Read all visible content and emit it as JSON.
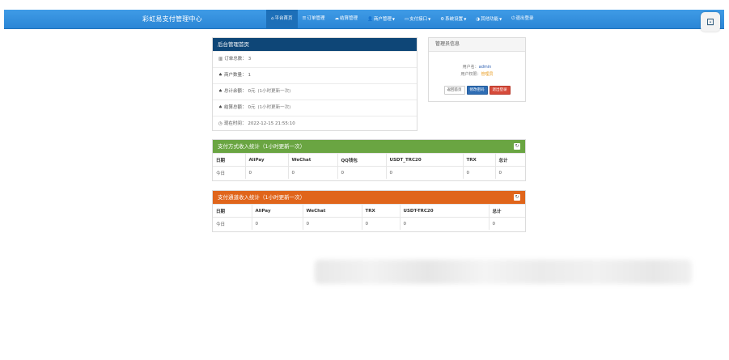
{
  "navbar": {
    "brand": "彩虹易支付管理中心",
    "items": [
      {
        "icon": "⌂",
        "label": "平台首页",
        "caret": false,
        "active": true
      },
      {
        "icon": "☰",
        "label": "订单管理",
        "caret": false,
        "active": false
      },
      {
        "icon": "☁",
        "label": "结算管理",
        "caret": false,
        "active": false
      },
      {
        "icon": "👤",
        "label": "商户管理",
        "caret": true,
        "active": false
      },
      {
        "icon": "▭",
        "label": "支付接口",
        "caret": true,
        "active": false
      },
      {
        "icon": "⚙",
        "label": "系统设置",
        "caret": true,
        "active": false
      },
      {
        "icon": "◑",
        "label": "其他功能",
        "caret": true,
        "active": false
      },
      {
        "icon": "⏻",
        "label": "退出登录",
        "caret": false,
        "active": false
      }
    ],
    "corner_icon": "⊡"
  },
  "dashboard": {
    "title": "后台管理首页",
    "rows": [
      {
        "icon": "▥",
        "label": "订单总数：",
        "value": "3",
        "note": ""
      },
      {
        "icon": "♠",
        "label": "商户数量：",
        "value": "1",
        "note": ""
      },
      {
        "icon": "♠",
        "label": "总计余额：",
        "value": "0元",
        "note": "(1小时更新一次)"
      },
      {
        "icon": "♠",
        "label": "结算总额：",
        "value": "0元",
        "note": "(1小时更新一次)"
      },
      {
        "icon": "◷",
        "label": "现在时间：",
        "value": "2022-12-15 21:55:10",
        "note": ""
      }
    ]
  },
  "admin": {
    "title": "管理员信息",
    "user_label": "用户名：",
    "user_value": "admin",
    "role_label": "用户权限：",
    "role_value": "管理员",
    "btn_home": "返回首页",
    "btn_pwd": "修改密码",
    "btn_logout": "退出登录"
  },
  "pay_type_stats": {
    "title": "支付方式收入统计（1小时更新一次）",
    "refresh_icon": "↻",
    "headers": [
      "日期",
      "AliPay",
      "WeChat",
      "QQ钱包",
      "USDT_TRC20",
      "TRX",
      "总计"
    ],
    "rows": [
      [
        "今日",
        "0",
        "0",
        "0",
        "0",
        "0",
        "0"
      ]
    ]
  },
  "channel_stats": {
    "title": "支付通道收入统计（1小时更新一次）",
    "refresh_icon": "↻",
    "headers": [
      "日期",
      "AliPay",
      "WeChat",
      "TRX",
      "USDT-TRC20",
      "总计"
    ],
    "rows": [
      [
        "今日",
        "0",
        "0",
        "0",
        "0",
        "0"
      ]
    ]
  }
}
